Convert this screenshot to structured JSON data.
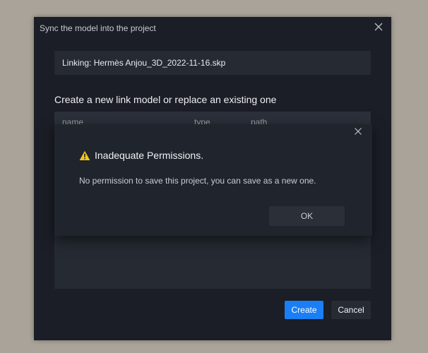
{
  "dialog": {
    "title": "Sync the model into the project",
    "linking_text": "Linking: Hermès Anjou_3D_2022-11-16.skp",
    "section_heading": "Create a new link model or replace an existing one",
    "table": {
      "columns": [
        "name",
        "type",
        "path"
      ]
    },
    "create_label": "Create",
    "cancel_label": "Cancel"
  },
  "alert": {
    "title": "Inadequate Permissions.",
    "message": "No permission to save this project, you can save as a new one.",
    "ok_label": "OK"
  },
  "icons": {
    "warning": "warning-triangle-icon",
    "close": "close-icon"
  },
  "colors": {
    "accent": "#1a7ef5",
    "warning": "#f5c518",
    "dialog_bg": "#1b1e26"
  }
}
